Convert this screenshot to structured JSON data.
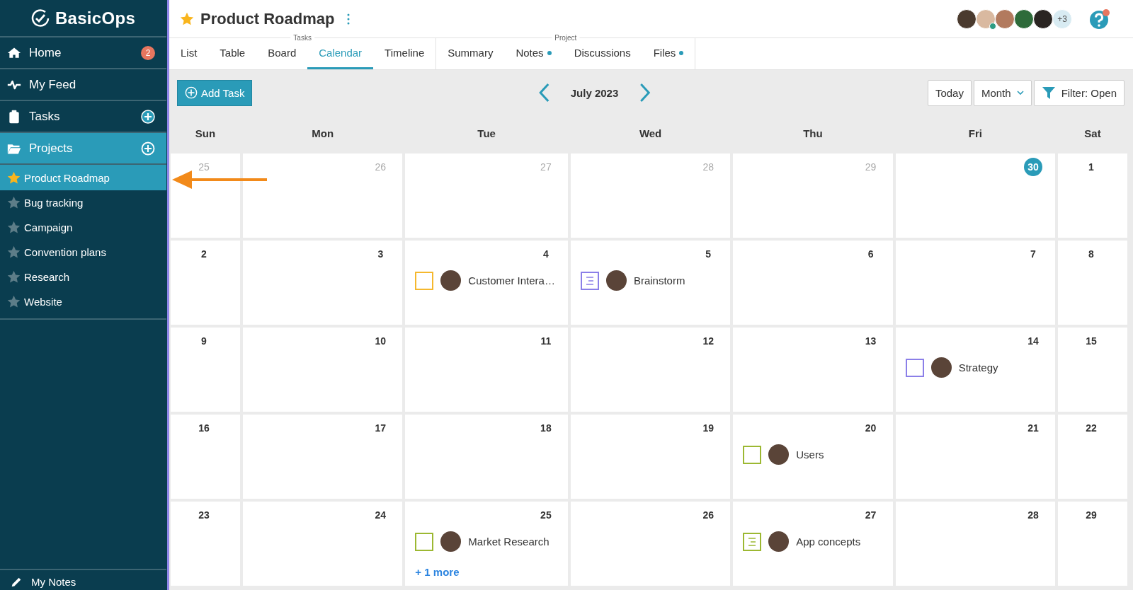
{
  "sidebar": {
    "logo": "BasicOps",
    "nav": [
      {
        "label": "Home",
        "badge": "2",
        "add": false,
        "selected": false
      },
      {
        "label": "My Feed",
        "add": false,
        "selected": false
      },
      {
        "label": "Tasks",
        "add": true,
        "selected": false
      },
      {
        "label": "Projects",
        "add": true,
        "selected": true
      }
    ],
    "projects": [
      {
        "label": "Product Roadmap",
        "selected": true,
        "starred": true
      },
      {
        "label": "Bug tracking",
        "selected": false,
        "starred": false
      },
      {
        "label": "Campaign",
        "selected": false,
        "starred": false
      },
      {
        "label": "Convention plans",
        "selected": false,
        "starred": false
      },
      {
        "label": "Research",
        "selected": false,
        "starred": false
      },
      {
        "label": "Website",
        "selected": false,
        "starred": false
      }
    ],
    "footer": "My Notes"
  },
  "header": {
    "title": "Product Roadmap",
    "starred": true,
    "more_avatars": "+3"
  },
  "tab_groups": [
    {
      "label": "Tasks",
      "tabs": [
        {
          "label": "List",
          "selected": false,
          "dot": false
        },
        {
          "label": "Table",
          "selected": false,
          "dot": false
        },
        {
          "label": "Board",
          "selected": false,
          "dot": false
        },
        {
          "label": "Calendar",
          "selected": true,
          "dot": false
        },
        {
          "label": "Timeline",
          "selected": false,
          "dot": false
        }
      ]
    },
    {
      "label": "Project",
      "tabs": [
        {
          "label": "Summary",
          "selected": false,
          "dot": false
        },
        {
          "label": "Notes",
          "selected": false,
          "dot": true
        },
        {
          "label": "Discussions",
          "selected": false,
          "dot": false
        },
        {
          "label": "Files",
          "selected": false,
          "dot": true
        }
      ]
    }
  ],
  "toolbar": {
    "add_button": "Add Task",
    "month": "July 2023",
    "today_button": "Today",
    "view_select": "Month",
    "filter_button": "Filter: Open"
  },
  "weekdays": [
    "Sun",
    "Mon",
    "Tue",
    "Wed",
    "Thu",
    "Fri",
    "Sat"
  ],
  "weeks": [
    [
      {
        "day": "25",
        "muted": true,
        "today": false
      },
      {
        "day": "26",
        "muted": true,
        "today": false
      },
      {
        "day": "27",
        "muted": true,
        "today": false
      },
      {
        "day": "28",
        "muted": true,
        "today": false
      },
      {
        "day": "29",
        "muted": true,
        "today": false
      },
      {
        "day": "30",
        "muted": false,
        "today": true
      },
      {
        "day": "1",
        "muted": false,
        "today": false
      }
    ],
    [
      {
        "day": "2",
        "muted": false,
        "today": false
      },
      {
        "day": "3",
        "muted": false,
        "today": false
      },
      {
        "day": "4",
        "muted": false,
        "today": false,
        "tasks": [
          {
            "kind": "task",
            "color": "#f5b82e",
            "title": "Customer Intera…"
          }
        ]
      },
      {
        "day": "5",
        "muted": false,
        "today": false,
        "tasks": [
          {
            "kind": "note",
            "color": "#8b7fe8",
            "title": "Brainstorm"
          }
        ]
      },
      {
        "day": "6",
        "muted": false,
        "today": false
      },
      {
        "day": "7",
        "muted": false,
        "today": false
      },
      {
        "day": "8",
        "muted": false,
        "today": false
      }
    ],
    [
      {
        "day": "9",
        "muted": false,
        "today": false
      },
      {
        "day": "10",
        "muted": false,
        "today": false
      },
      {
        "day": "11",
        "muted": false,
        "today": false
      },
      {
        "day": "12",
        "muted": false,
        "today": false
      },
      {
        "day": "13",
        "muted": false,
        "today": false
      },
      {
        "day": "14",
        "muted": false,
        "today": false,
        "tasks": [
          {
            "kind": "task",
            "color": "#8b7fe8",
            "title": "Strategy"
          }
        ]
      },
      {
        "day": "15",
        "muted": false,
        "today": false
      }
    ],
    [
      {
        "day": "16",
        "muted": false,
        "today": false
      },
      {
        "day": "17",
        "muted": false,
        "today": false
      },
      {
        "day": "18",
        "muted": false,
        "today": false
      },
      {
        "day": "19",
        "muted": false,
        "today": false
      },
      {
        "day": "20",
        "muted": false,
        "today": false,
        "tasks": [
          {
            "kind": "task",
            "color": "#9cb832",
            "title": "Users"
          }
        ]
      },
      {
        "day": "21",
        "muted": false,
        "today": false
      },
      {
        "day": "22",
        "muted": false,
        "today": false
      }
    ],
    [
      {
        "day": "23",
        "muted": false,
        "today": false
      },
      {
        "day": "24",
        "muted": false,
        "today": false
      },
      {
        "day": "25",
        "muted": false,
        "today": false,
        "tasks": [
          {
            "kind": "task",
            "color": "#9cb832",
            "title": "Market Research"
          }
        ],
        "more": "+ 1 more"
      },
      {
        "day": "26",
        "muted": false,
        "today": false
      },
      {
        "day": "27",
        "muted": false,
        "today": false,
        "tasks": [
          {
            "kind": "note",
            "color": "#9cb832",
            "title": "App concepts"
          }
        ]
      },
      {
        "day": "28",
        "muted": false,
        "today": false
      },
      {
        "day": "29",
        "muted": false,
        "today": false
      }
    ]
  ]
}
